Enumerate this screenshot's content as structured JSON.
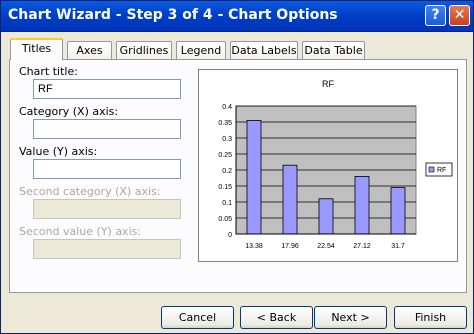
{
  "window": {
    "title": "Chart Wizard - Step 3 of 4 - Chart Options",
    "help_glyph": "?",
    "close_glyph": "✕"
  },
  "tabs": [
    {
      "label": "Titles",
      "active": true
    },
    {
      "label": "Axes",
      "active": false
    },
    {
      "label": "Gridlines",
      "active": false
    },
    {
      "label": "Legend",
      "active": false
    },
    {
      "label": "Data Labels",
      "active": false
    },
    {
      "label": "Data Table",
      "active": false
    }
  ],
  "form": {
    "chart_title_label": "Chart title:",
    "chart_title_value": "RF",
    "category_x_label": "Category (X) axis:",
    "category_x_value": "",
    "value_y_label": "Value (Y) axis:",
    "value_y_value": "",
    "second_category_label": "Second category (X) axis:",
    "second_category_value": "",
    "second_value_label": "Second value (Y) axis:",
    "second_value_value": ""
  },
  "buttons": {
    "cancel": "Cancel",
    "back": "< Back",
    "next": "Next >",
    "finish": "Finish"
  },
  "chart_data": {
    "type": "bar",
    "title": "RF",
    "categories": [
      "13.38",
      "17.96",
      "22.54",
      "27.12",
      "31.7"
    ],
    "series": [
      {
        "name": "RF",
        "values": [
          0.355,
          0.215,
          0.11,
          0.18,
          0.145
        ]
      }
    ],
    "ylim": [
      0,
      0.4
    ],
    "yticks": [
      "0",
      "0.05",
      "0.1",
      "0.15",
      "0.2",
      "0.25",
      "0.3",
      "0.35",
      "0.4"
    ],
    "grid": true,
    "legend": "right",
    "colors": {
      "bar": "#9999FF",
      "plot_bg": "#C0C0C0"
    }
  }
}
